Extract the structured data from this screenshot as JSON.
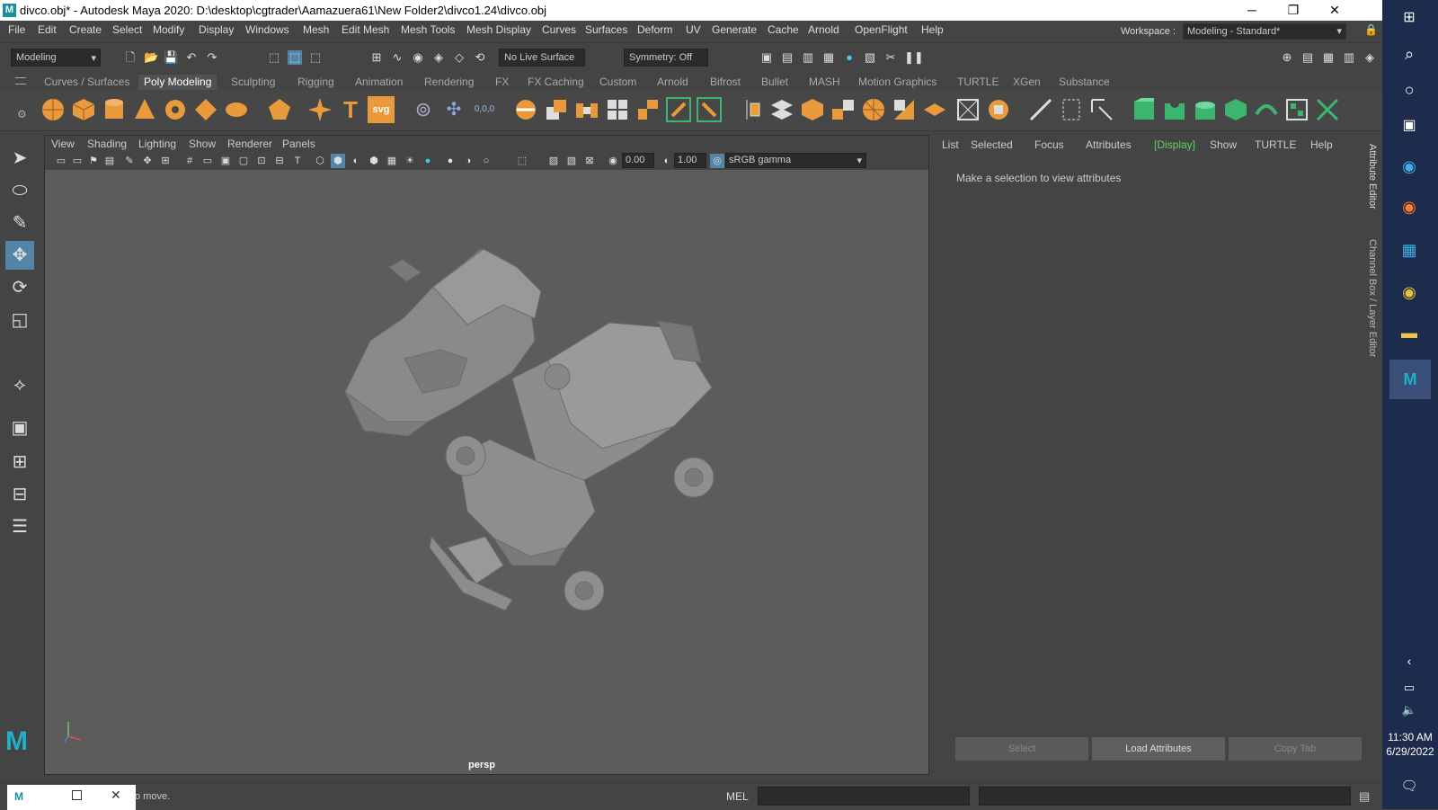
{
  "window": {
    "title": "divco.obj* - Autodesk Maya 2020: D:\\desktop\\cgtrader\\Aamazuera61\\New Folder2\\divco1.24\\divco.obj",
    "app_icon": "M",
    "minimize": "─",
    "restore": "❐",
    "close": "✕"
  },
  "menubar": {
    "items": [
      "File",
      "Edit",
      "Create",
      "Select",
      "Modify",
      "Display",
      "Windows",
      "Mesh",
      "Edit Mesh",
      "Mesh Tools",
      "Mesh Display",
      "Curves",
      "Surfaces",
      "Deform",
      "UV",
      "Generate",
      "Cache",
      "Arnold",
      "OpenFlight",
      "Help"
    ],
    "workspace_label": "Workspace :",
    "workspace_value": "Modeling - Standard*"
  },
  "statusline": {
    "mode": "Modeling",
    "live_surface": "No Live Surface",
    "symmetry": "Symmetry: Off"
  },
  "shelf_tabs": {
    "items": [
      "Curves / Surfaces",
      "Poly Modeling",
      "Sculpting",
      "Rigging",
      "Animation",
      "Rendering",
      "FX",
      "FX Caching",
      "Custom",
      "Arnold",
      "Bifrost",
      "Bullet",
      "MASH",
      "Motion Graphics",
      "TURTLE",
      "XGen",
      "Substance"
    ],
    "active": "Poly Modeling"
  },
  "shelf": {
    "text_tool": "T",
    "svg_tool": "svg",
    "num_tool": "0,0,0"
  },
  "viewport": {
    "menu": [
      "View",
      "Shading",
      "Lighting",
      "Show",
      "Renderer",
      "Panels"
    ],
    "exposure": "0.00",
    "gamma": "1.00",
    "color_space": "sRGB gamma",
    "camera": "persp"
  },
  "attribute_editor": {
    "menu": [
      "List",
      "Selected",
      "Focus",
      "Attributes",
      "[Display]",
      "Show",
      "TURTLE",
      "Help"
    ],
    "message": "Make a selection to view attributes",
    "buttons": [
      "Select",
      "Load Attributes",
      "Copy Tab"
    ],
    "side_tabs": [
      "Attribute Editor",
      "Channel Box / Layer Editor"
    ]
  },
  "bottom": {
    "help_text": "o move.",
    "mel_label": "MEL"
  },
  "taskbar": {
    "time": "11:30 AM",
    "date": "6/29/2022"
  },
  "colors": {
    "accent": "#5fd35f",
    "shelf_orange": "#e89a3c",
    "shelf_green": "#3bb56f",
    "taskbar": "#1d2b4d"
  }
}
